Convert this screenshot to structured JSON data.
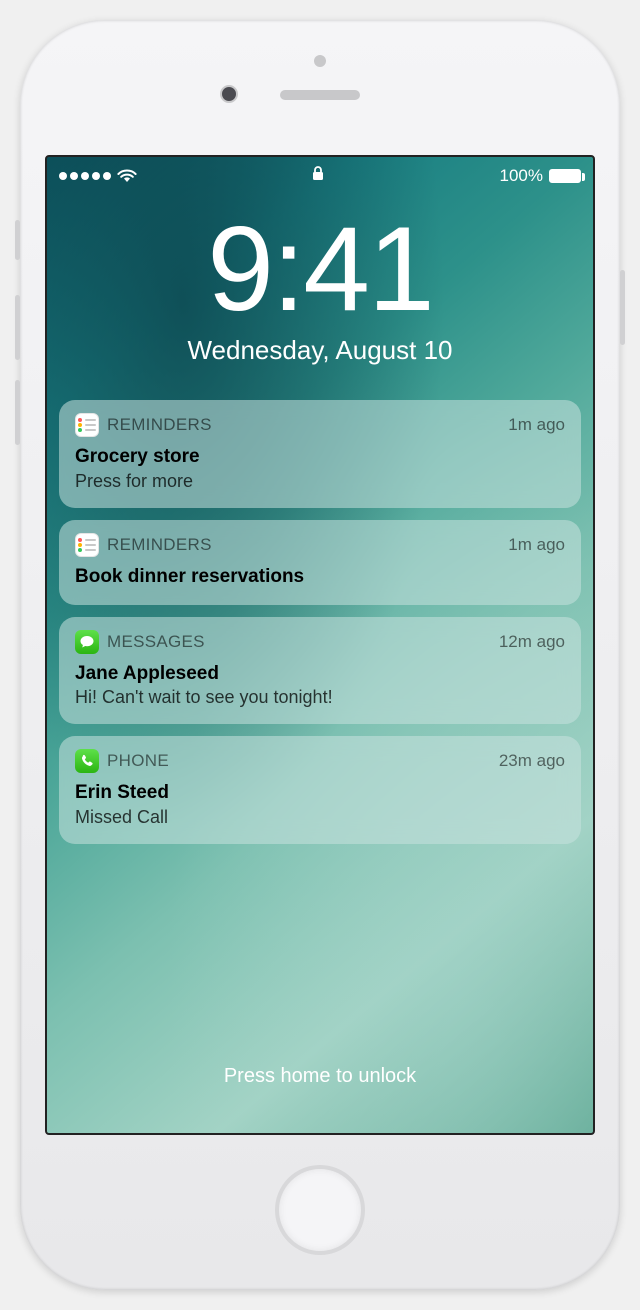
{
  "status": {
    "battery_pct": "100%"
  },
  "clock": {
    "time": "9:41",
    "date": "Wednesday, August 10"
  },
  "notifications": [
    {
      "app": "REMINDERS",
      "icon": "reminders",
      "time": "1m ago",
      "title": "Grocery store",
      "body": "Press for more"
    },
    {
      "app": "REMINDERS",
      "icon": "reminders",
      "time": "1m ago",
      "title": "Book dinner reservations",
      "body": ""
    },
    {
      "app": "MESSAGES",
      "icon": "messages",
      "time": "12m ago",
      "title": "Jane Appleseed",
      "body": "Hi! Can't wait to see you tonight!"
    },
    {
      "app": "PHONE",
      "icon": "phone",
      "time": "23m ago",
      "title": "Erin Steed",
      "body": "Missed Call"
    }
  ],
  "unlock_hint": "Press home to unlock"
}
